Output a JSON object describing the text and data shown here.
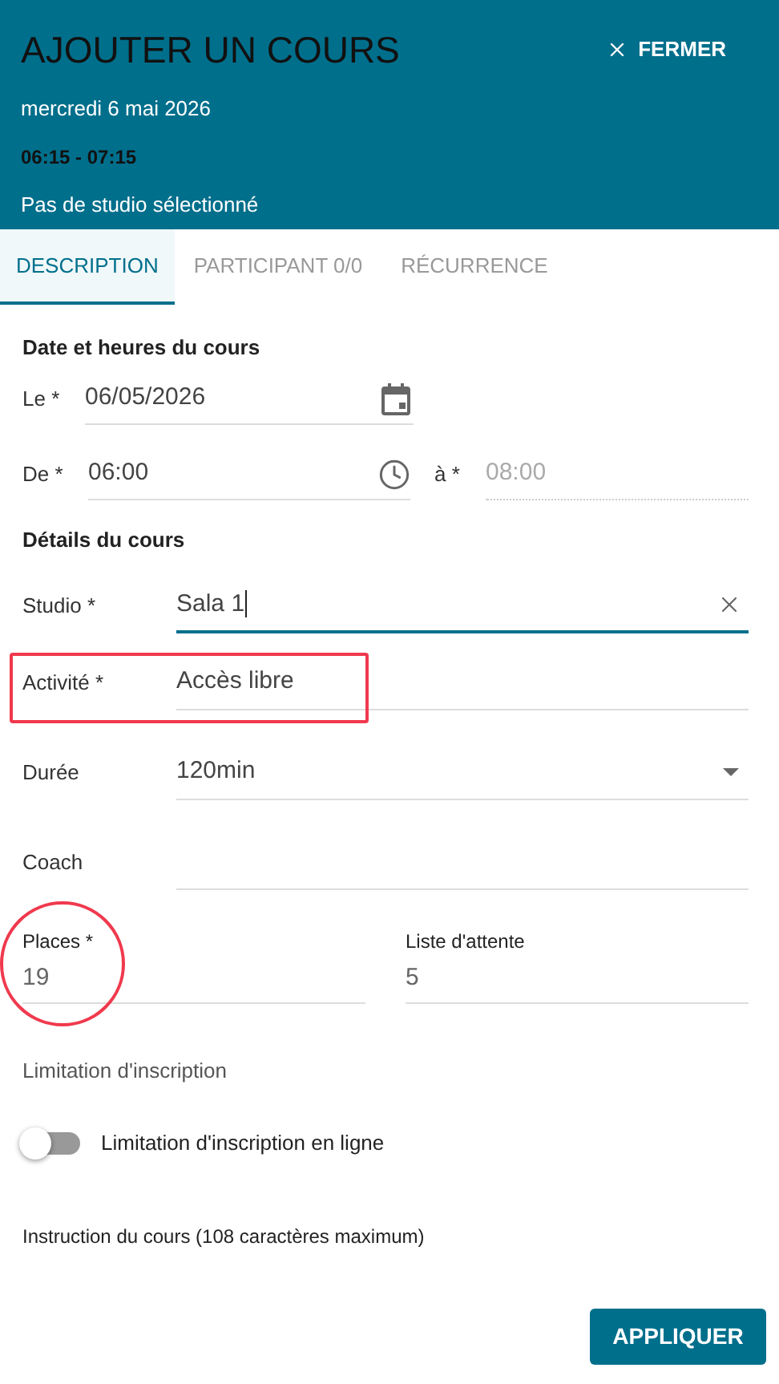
{
  "header": {
    "title": "AJOUTER UN COURS",
    "close_label": "FERMER",
    "date": "mercredi 6 mai 2026",
    "time": "06:15 - 07:15",
    "studio": "Pas de studio sélectionné"
  },
  "tabs": [
    {
      "label": "DESCRIPTION",
      "selected": true
    },
    {
      "label": "PARTICIPANT 0/0",
      "selected": false
    },
    {
      "label": "RÉCURRENCE",
      "selected": false
    }
  ],
  "schedule": {
    "heading": "Date et heures du cours",
    "date": {
      "label": "Le *",
      "value": "06/05/2026"
    },
    "start": {
      "label": "De *",
      "value": "06:00"
    },
    "end": {
      "label": "à *",
      "value": "08:00",
      "disabled": true
    }
  },
  "details": {
    "heading": "Détails du cours",
    "fields": [
      {
        "kind": "autocomplete",
        "label": "Studio *",
        "value": "Sala 1",
        "focused": true,
        "boxed": false
      },
      {
        "kind": "text",
        "label": "Activité *",
        "value": "Accès libre",
        "focused": false,
        "boxed": true
      },
      {
        "kind": "select",
        "label": "Durée",
        "value": "120min",
        "focused": false,
        "boxed": false
      },
      {
        "kind": "text",
        "label": "Coach",
        "focused": false,
        "boxed": false
      }
    ]
  },
  "capacity": [
    {
      "label": "Places *",
      "value": "19",
      "circled": true
    },
    {
      "label": "Liste d'attente",
      "value": "5",
      "circled": false
    }
  ],
  "limitation": {
    "heading": "Limitation d'inscription",
    "toggle": {
      "label": "Limitation d'inscription en ligne",
      "on": false
    }
  },
  "instruction": {
    "label": "Instruction du cours (108 caractères maximum)"
  },
  "apply_button": "APPLIQUER"
}
